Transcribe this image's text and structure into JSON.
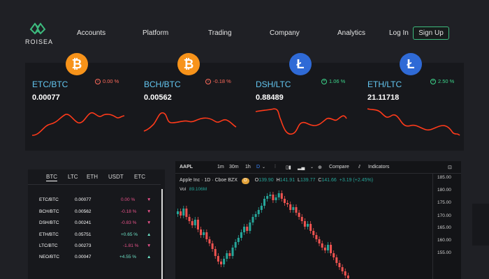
{
  "nav": {
    "logo_text": "ROISEA",
    "items": [
      "Accounts",
      "Platform",
      "Trading",
      "Company",
      "Analytics"
    ],
    "login": "Log In",
    "signup": "Sign Up"
  },
  "cards": [
    {
      "pair": "ETC/BTC",
      "change": "0.00 %",
      "price": "0.00077",
      "coin": "btc",
      "trend": "down"
    },
    {
      "pair": "BCH/BTC",
      "change": "-0.18 %",
      "price": "0.00562",
      "coin": "btc",
      "trend": "down"
    },
    {
      "pair": "DSH/LTC",
      "change": "1.06 %",
      "price": "0.88489",
      "coin": "ltc",
      "trend": "up"
    },
    {
      "pair": "ETH/LTC",
      "change": "2.50 %",
      "price": "21.11718",
      "coin": "ltc",
      "trend": "up"
    }
  ],
  "market": {
    "tabs": [
      "BTC",
      "LTC",
      "ETH",
      "USDT",
      "ETC"
    ],
    "rows": [
      {
        "pair": "ETC/BTC",
        "price": "0.00077",
        "change": "0.00 %",
        "dir": "down"
      },
      {
        "pair": "BCH/BTC",
        "price": "0.00562",
        "change": "-0.18 %",
        "dir": "down"
      },
      {
        "pair": "DSH/BTC",
        "price": "0.00241",
        "change": "-0.83 %",
        "dir": "down"
      },
      {
        "pair": "ETH/BTC",
        "price": "0.05751",
        "change": "+0.65 %",
        "dir": "up"
      },
      {
        "pair": "LTC/BTC",
        "price": "0.00273",
        "change": "-1.81 %",
        "dir": "down"
      },
      {
        "pair": "NEO/BTC",
        "price": "0.00047",
        "change": "+4.55 %",
        "dir": "up"
      }
    ]
  },
  "chart": {
    "symbol": "AAPL",
    "intervals": [
      "1m",
      "30m",
      "1h",
      "D"
    ],
    "compare": "Compare",
    "indicators": "Indicators",
    "title": "Apple Inc · 1D · Cboe BZX",
    "badge": "D",
    "ohlc": {
      "O": "139.90",
      "H": "141.91",
      "L": "139.77",
      "C": "141.66",
      "change": "+3.19 (+2.45%)"
    },
    "vol_label": "Vol",
    "vol_value": "89.106M",
    "yticks": [
      "185.00",
      "180.00",
      "175.00",
      "170.00",
      "165.00",
      "160.00",
      "155.00"
    ]
  },
  "colors": {
    "up": "#26a69a",
    "down": "#ef5350",
    "accent": "#63c6f0",
    "green": "#3dbb7e",
    "line": "#e0351b"
  }
}
